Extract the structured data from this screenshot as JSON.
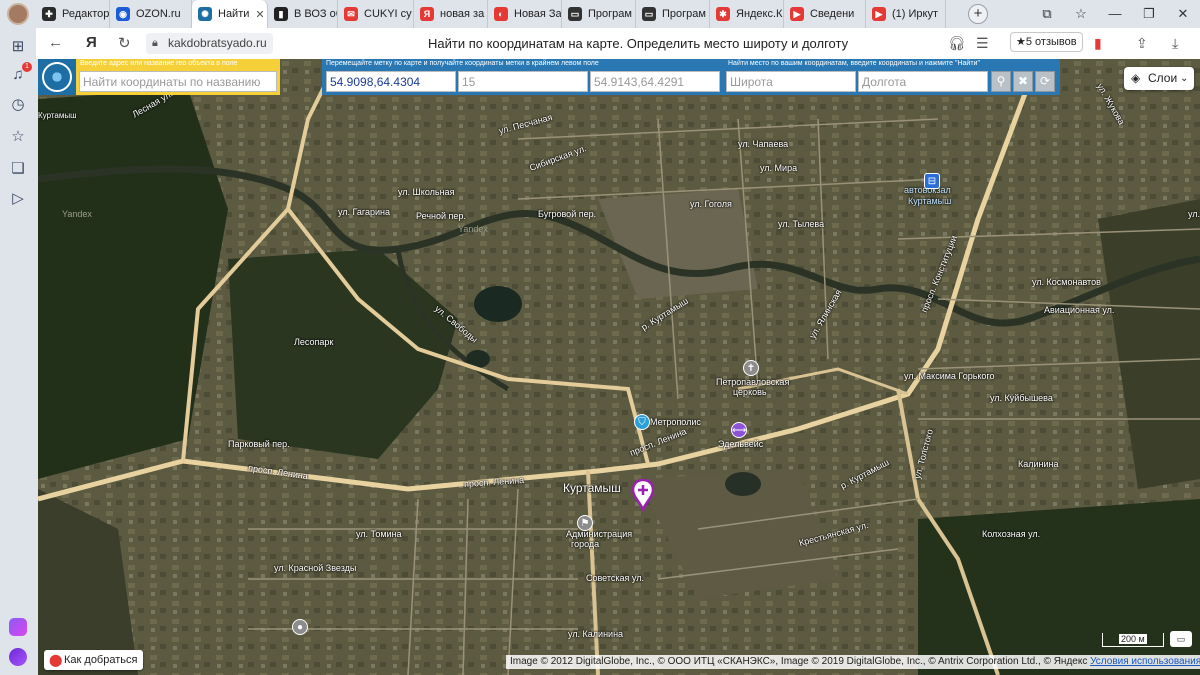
{
  "tabs": [
    {
      "label": "Редактор",
      "fav_color": "#2b2b2b",
      "fav_glyph": "✚"
    },
    {
      "label": "OZON.ru",
      "fav_color": "#1e5bd6",
      "fav_glyph": "◉"
    },
    {
      "label": "Найти",
      "fav_color": "#1c6ea4",
      "fav_glyph": "✺"
    },
    {
      "label": "В ВОЗ об",
      "fav_color": "#222222",
      "fav_glyph": "▮"
    },
    {
      "label": "CUKYI су",
      "fav_color": "#e53935",
      "fav_glyph": "✉"
    },
    {
      "label": "новая за",
      "fav_color": "#e53935",
      "fav_glyph": "Я"
    },
    {
      "label": "Новая За",
      "fav_color": "#e53935",
      "fav_glyph": "◐"
    },
    {
      "label": "Програм",
      "fav_color": "#333333",
      "fav_glyph": "▭"
    },
    {
      "label": "Програм",
      "fav_color": "#333333",
      "fav_glyph": "▭"
    },
    {
      "label": "Яндекс.К",
      "fav_color": "#e53935",
      "fav_glyph": "✱"
    },
    {
      "label": "Сведени",
      "fav_color": "#e53935",
      "fav_glyph": "▶"
    },
    {
      "label": "(1) Иркут",
      "fav_color": "#e53935",
      "fav_glyph": "▶"
    }
  ],
  "address_bar": {
    "url": "kakdobratsyado.ru",
    "page_title": "Найти по координатам на карте. Определить место широту и долготу",
    "reviews": "★5 отзывов"
  },
  "search_panel": {
    "name_hint": "Введите адрес или название гео объекта в поле",
    "name_placeholder": "Найти координаты по названию",
    "move_hint": "Перемещайте метку по карте и получайте координаты метки в крайнем левом поле",
    "marker_coords": "54.9098,64.4304",
    "zoom": "15",
    "corner_coords": "54.9143,64.4291",
    "find_hint": "Найти место по вашим координатам, введите координаты и нажмите \"Найти\"",
    "lat_placeholder": "Широта",
    "lon_placeholder": "Долгота"
  },
  "map": {
    "layers_label": "Слои",
    "howto_label": "Как добраться",
    "scale_label": "200 м",
    "copyright": "Image © 2012 DigitalGlobe, Inc., © ООО ИТЦ «СКАНЭКС», Image © 2019 DigitalGlobe, Inc., © Antrix Corporation Ltd., © Яндекс",
    "terms_link": "Условия использования",
    "labels": {
      "town": "Куртамыш",
      "lespark": "Лесопарк",
      "bus_station_1": "автовокзал",
      "bus_station_2": "Куртамыш",
      "church_1": "Петропавловская",
      "church_2": "церковь",
      "metropolis": "Метрополис",
      "edelweiss": "Эдельвейс",
      "admin_1": "Администрация",
      "admin_2": "города",
      "lenina_1": "просп. Ленина",
      "lenina_2": "просп. Ленина",
      "lenina_3": "просп. Ленина",
      "kurtamysh_river": "р. Куртамыш",
      "kurtamysh_river_2": "р. Куртамыш",
      "svobody": "ул. Свободы",
      "mira": "ул. Мира",
      "gogolya": "ул. Гоголя",
      "kosmonavtov": "ул. Космонавтов",
      "gorkogo": "ул. Максима Горького",
      "kuibysheva": "ул. Куйбышева",
      "parkovy": "Парковый пер.",
      "tomina": "ул. Томина",
      "krasnoy_zvezdy": "ул. Красной Звезды",
      "sovetskaya": "Советская ул.",
      "kalinina": "ул. Калинина",
      "kolkhoznaya": "Колхозная ул.",
      "aviatsionnaya": "Авиационная ул.",
      "konstitutsii": "просп. Конституции",
      "rechnoy": "Речной пер.",
      "shkolnaya": "ул. Школьная",
      "gagarina": "ул. Гагарина",
      "sibirskaya": "Сибирская ул.",
      "bugrovoy": "Бугровой пер.",
      "chapaeva": "ул. Чапаева",
      "tyleva": "ул. Тылева",
      "krestyanskaya": "Крестьянская ул.",
      "kalinina_2": "Калинина",
      "ulitsa_fragment": "ул.",
      "pesch": "ул. Песчаная",
      "lyalina": "ул. Ялинская",
      "tolstogo": "ул. Толстого",
      "yandex_wm": "Yandex",
      "yandex_wm_2": "Yandex",
      "lesnaya": "Лесная ул.",
      "zhukova": "ул. Жукова",
      "kurtamysh_top": "Куртамыш"
    }
  }
}
